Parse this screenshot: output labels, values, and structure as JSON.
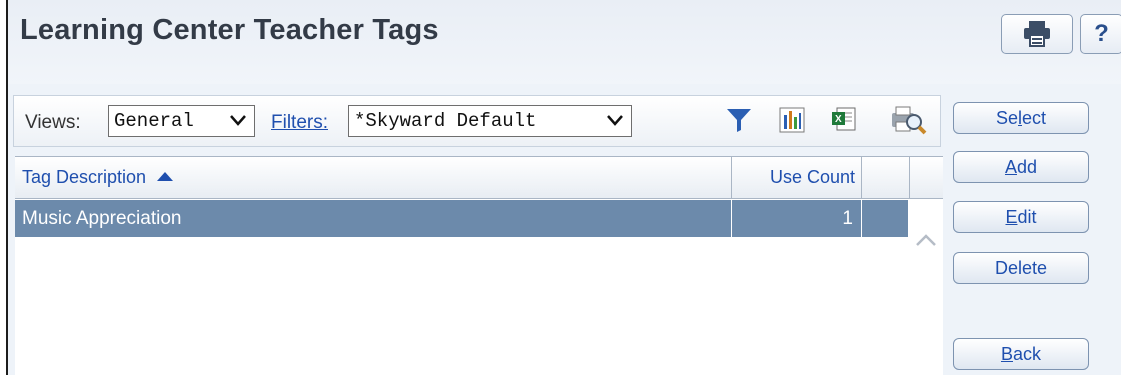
{
  "header": {
    "title": "Learning Center Teacher Tags",
    "help_label": "?"
  },
  "toolbar": {
    "views_label": "Views:",
    "views_value": "General",
    "filters_label": "Filters:",
    "filters_value": "*Skyward Default"
  },
  "grid": {
    "columns": [
      "Tag Description",
      "Use Count"
    ],
    "rows": [
      {
        "description": "Music Appreciation",
        "use_count": "1"
      }
    ]
  },
  "buttons": {
    "select": {
      "pre": "Se",
      "key": "l",
      "post": "ect"
    },
    "add": {
      "pre": "",
      "key": "A",
      "post": "dd"
    },
    "edit": {
      "pre": "",
      "key": "E",
      "post": "dit"
    },
    "delete": {
      "pre": "",
      "key": "",
      "post": "Delete"
    },
    "back": {
      "pre": "",
      "key": "B",
      "post": "ack"
    }
  },
  "colors": {
    "link": "#1f4fae",
    "selected_row": "#6c8aab",
    "title": "#333b47"
  },
  "icons": [
    "print-icon",
    "help-icon",
    "filter-icon",
    "chart-icon",
    "excel-export-icon",
    "print-preview-icon",
    "sort-ascending-icon",
    "chevron-down-icon",
    "scroll-up-icon"
  ]
}
